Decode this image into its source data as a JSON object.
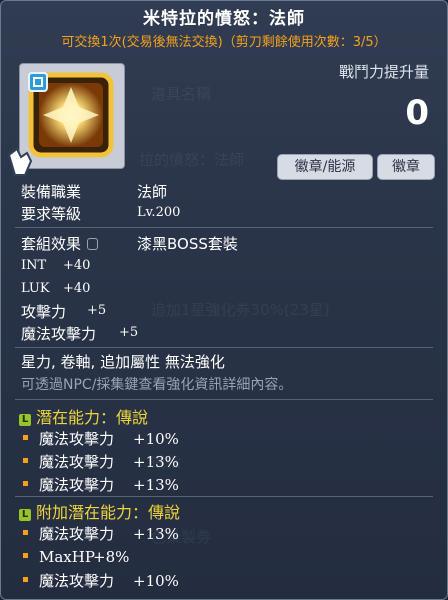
{
  "item": {
    "name": "米特拉的憤怒：法師",
    "trade_note": "可交換1次(交易後無法交換)（剪刀剩餘使用次數：3/5）",
    "icon": "emblem-icon"
  },
  "power": {
    "label": "戰鬥力提升量",
    "value": "0"
  },
  "badges": [
    "徽章/能源",
    "徽章"
  ],
  "requirements": [
    {
      "label": "裝備職業",
      "value": "法師"
    },
    {
      "label": "要求等級",
      "value": "Lv.200"
    }
  ],
  "set_effect": {
    "label": "套組效果",
    "value": "漆黑BOSS套裝"
  },
  "stats": [
    {
      "label": "INT",
      "value": "+40"
    },
    {
      "label": "LUK",
      "value": "+40"
    },
    {
      "label": "攻擊力",
      "value": "+5"
    },
    {
      "label": "魔法攻擊力",
      "value": "+5"
    }
  ],
  "traits": "星力, 卷軸, 追加屬性 無法強化",
  "note": "可透過NPC/採集鍵查看強化資訊詳細內容。",
  "potential": {
    "title": "潛在能力",
    "grade": "傳說",
    "separator": "：",
    "lines": [
      {
        "label": "魔法攻擊力",
        "value": "+10%"
      },
      {
        "label": "魔法攻擊力",
        "value": "+13%"
      },
      {
        "label": "魔法攻擊力",
        "value": "+13%"
      }
    ]
  },
  "bonus_potential": {
    "title": "附加潛在能力",
    "grade": "傳說",
    "separator": "：",
    "lines": [
      {
        "label": "魔法攻擊力",
        "value": "+13%"
      },
      {
        "label": "MaxHP",
        "value": "+8%"
      },
      {
        "label": "魔法攻擊力",
        "value": "+10%"
      }
    ]
  },
  "colors": {
    "title": "#ffffff",
    "trade_note": "#f5a11c",
    "grade": "#eed63a",
    "potential_icon": "#98c42a"
  }
}
